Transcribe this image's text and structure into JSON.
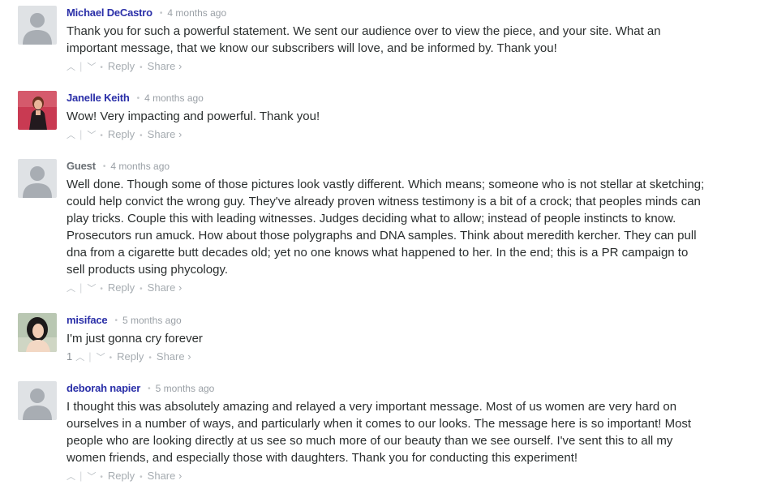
{
  "comments": [
    {
      "author": "Michael DeCastro",
      "time": "4 months ago",
      "text": "Thank you for such a powerful statement. We sent our audience over to view the piece, and your site. What an important message, that we know our subscribers will love, and be informed by. Thank you!",
      "upvote_count": "",
      "reply_label": "Reply",
      "share_label": "Share ›"
    },
    {
      "author": "Janelle Keith",
      "time": "4 months ago",
      "text": "Wow! Very impacting and powerful. Thank you!",
      "upvote_count": "",
      "reply_label": "Reply",
      "share_label": "Share ›"
    },
    {
      "author": "Guest",
      "time": "4 months ago",
      "text": "Well done. Though some of those pictures look vastly different. Which means; someone who is not stellar at sketching; could help convict the wrong guy. They've already proven witness testimony is a bit of a crock; that peoples minds can play tricks. Couple this with leading witnesses. Judges deciding what to allow; instead of people instincts to know. Prosecutors run amuck. How about those polygraphs and DNA samples. Think about meredith kercher. They can pull dna from a cigarette butt decades old; yet no one knows what happened to her. In the end; this is a PR campaign to sell products using phycology.",
      "upvote_count": "",
      "reply_label": "Reply",
      "share_label": "Share ›"
    },
    {
      "author": "misiface",
      "time": "5 months ago",
      "text": "I'm just gonna cry forever",
      "upvote_count": "1",
      "reply_label": "Reply",
      "share_label": "Share ›"
    },
    {
      "author": "deborah napier",
      "time": "5 months ago",
      "text": "I thought this was absolutely amazing and relayed a very important message. Most of us women are very hard on ourselves in a number of ways, and particularly when it comes to our looks. The message here is so important! Most people who are looking directly at us see so much more of our beauty than we see ourself. I've sent this to all my women friends, and especially those with daughters. Thank you for conducting this experiment!",
      "upvote_count": "",
      "reply_label": "Reply",
      "share_label": "Share ›"
    }
  ],
  "icons": {
    "upvote": "chevron-up-icon",
    "downvote": "chevron-down-icon"
  },
  "colors": {
    "author": "#2a2fa8",
    "guest_author": "#6a6f74",
    "meta": "#9aa0a6",
    "text": "#2a2e2e",
    "avatar_default": "#dfe2e5"
  }
}
